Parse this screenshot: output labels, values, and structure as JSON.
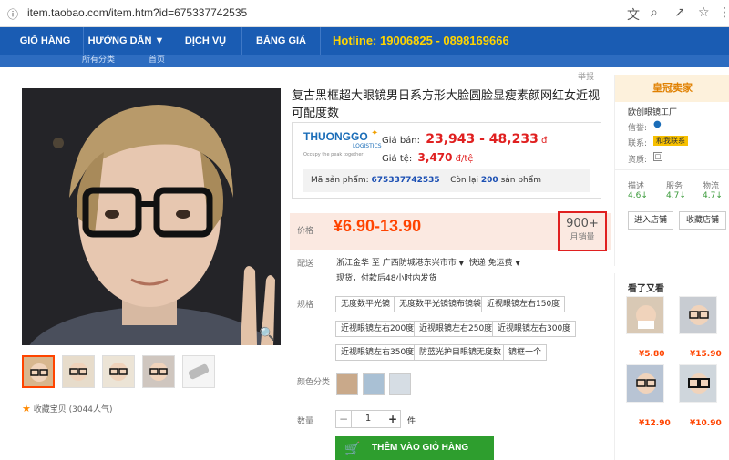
{
  "browser": {
    "url": "item.taobao.com/item.htm?id=675337742535"
  },
  "nav": {
    "items": [
      "GIỎ HÀNG",
      "HƯỚNG DẪN",
      "DỊCH VỤ",
      "BẢNG GIÁ"
    ],
    "hotline": "Hotline: 19006825 - 0898169666",
    "sub_category": "所有分类",
    "sub_home": "首页"
  },
  "product": {
    "title": "复古黑框超大眼镜男日系方形大脸圆脸显瘦素颜网红女近视可配度数",
    "corner": "举报",
    "favorite": "收藏宝贝 (3044人气)"
  },
  "thuonggo": {
    "brand": "THUONGGO",
    "brand_sub": "LOGISTICS",
    "slogan": "Occupy the peak together!",
    "price_label": "Giá bán:",
    "price_vnd": "23,943 - 48,233",
    "price_unit": "đ",
    "rate_label": "Giá tệ:",
    "rate": "3,470",
    "rate_unit": "đ/tệ",
    "code_label": "Mã sản phẩm:",
    "code": "675337742535",
    "remain_label": "Còn lại",
    "remain": "200",
    "remain_unit": "sản phẩm"
  },
  "price": {
    "label": "价格",
    "value": "¥6.90-13.90",
    "sales": "900+",
    "sales_label": "月销量"
  },
  "shipping": {
    "label": "配送",
    "route": "浙江金华 至 广西防城港东兴市市",
    "method": "快递 免运费",
    "note": "现货，付款后48小时内发货"
  },
  "spec": {
    "label": "规格",
    "options": [
      "无度数平光镜",
      "无度数平光镜镜布镜袋",
      "近视眼镜左右150度",
      "近视眼镜左右200度",
      "近视眼镜左右250度",
      "近视眼镜左右300度",
      "近视眼镜左右350度",
      "防蓝光护目眼镜无度数",
      "镜框一个"
    ]
  },
  "color": {
    "label": "颜色分类"
  },
  "quantity": {
    "label": "数量",
    "value": "1",
    "minus": "−",
    "plus": "+",
    "unit": "件"
  },
  "cart": {
    "label": "THÊM VÀO GIỎ HÀNG"
  },
  "seller": {
    "header": "皇冠卖家",
    "name": "欧创眼镜工厂",
    "credit": "信誉:",
    "contact": "联系:",
    "contact_btn": "和我联系",
    "qual": "资质:",
    "scores": [
      {
        "label": "描述",
        "value": "4.6"
      },
      {
        "label": "服务",
        "value": "4.7"
      },
      {
        "label": "物流",
        "value": "4.7"
      }
    ],
    "enter_shop": "进入店铺",
    "fav_shop": "收藏店铺"
  },
  "related": {
    "title": "看了又看",
    "prices": [
      "¥5.80",
      "¥15.90",
      "¥12.90",
      "¥10.90"
    ]
  },
  "colors": {
    "nav": "#1a5cb3",
    "hotline": "#ffd400",
    "price": "#ff4400",
    "cart": "#2e9e2e",
    "highlight": "#e02020"
  }
}
